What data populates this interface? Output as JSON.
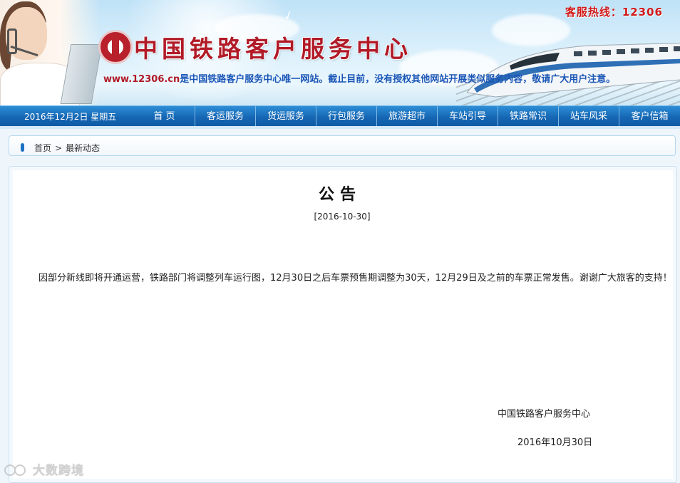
{
  "header": {
    "logo_title": "中国铁路客户服务中心",
    "url_text": "www.12306.cn",
    "notice_text": "是中国铁路客户服务中心唯一网站。截止目前，没有授权其他网站开展类似服务内容，敬请广大用户注意。",
    "hotline": "客服热线：12306"
  },
  "nav": {
    "date": "2016年12月2日 星期五",
    "items": [
      {
        "label": "首  页"
      },
      {
        "label": "客运服务"
      },
      {
        "label": "货运服务"
      },
      {
        "label": "行包服务"
      },
      {
        "label": "旅游超市"
      },
      {
        "label": "车站引导"
      },
      {
        "label": "铁路常识"
      },
      {
        "label": "站车风采"
      },
      {
        "label": "客户信箱"
      }
    ]
  },
  "breadcrumb": {
    "home": "首页",
    "separator": ">",
    "current": "最新动态"
  },
  "article": {
    "title": "公告",
    "date": "[2016-10-30]",
    "body": "因部分新线即将开通运营，铁路部门将调整列车运行图，12月30日之后车票预售期调整为30天，12月29日及之前的车票正常发售。谢谢广大旅客的支持！",
    "signature_org": "中国铁路客户服务中心",
    "signature_date": "2016年10月30日"
  },
  "watermark": {
    "text": "大数跨境"
  },
  "colors": {
    "nav_blue": "#1566b3",
    "brand_red": "#b11a27",
    "link_blue": "#1a56b6"
  }
}
